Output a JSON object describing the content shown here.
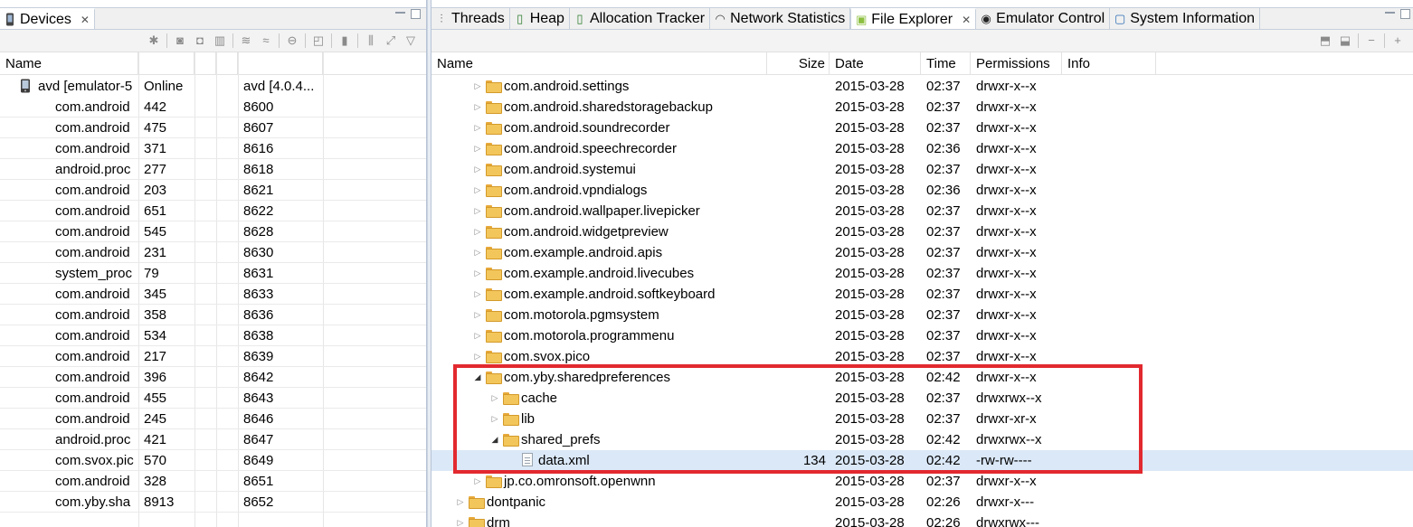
{
  "devices_panel": {
    "tab_label": "Devices",
    "columns": [
      "Name",
      "",
      "",
      "",
      ""
    ],
    "device": {
      "name": "avd [emulator-5",
      "status": "Online",
      "version": "avd [4.0.4..."
    },
    "processes": [
      {
        "name": "com.android",
        "pid": "442",
        "port": "8600"
      },
      {
        "name": "com.android",
        "pid": "475",
        "port": "8607"
      },
      {
        "name": "com.android",
        "pid": "371",
        "port": "8616"
      },
      {
        "name": "android.proc",
        "pid": "277",
        "port": "8618"
      },
      {
        "name": "com.android",
        "pid": "203",
        "port": "8621"
      },
      {
        "name": "com.android",
        "pid": "651",
        "port": "8622"
      },
      {
        "name": "com.android",
        "pid": "545",
        "port": "8628"
      },
      {
        "name": "com.android",
        "pid": "231",
        "port": "8630"
      },
      {
        "name": "system_proc",
        "pid": "79",
        "port": "8631"
      },
      {
        "name": "com.android",
        "pid": "345",
        "port": "8633"
      },
      {
        "name": "com.android",
        "pid": "358",
        "port": "8636"
      },
      {
        "name": "com.android",
        "pid": "534",
        "port": "8638"
      },
      {
        "name": "com.android",
        "pid": "217",
        "port": "8639"
      },
      {
        "name": "com.android",
        "pid": "396",
        "port": "8642"
      },
      {
        "name": "com.android",
        "pid": "455",
        "port": "8643"
      },
      {
        "name": "com.android",
        "pid": "245",
        "port": "8646"
      },
      {
        "name": "android.proc",
        "pid": "421",
        "port": "8647"
      },
      {
        "name": "com.svox.pic",
        "pid": "570",
        "port": "8649"
      },
      {
        "name": "com.android",
        "pid": "328",
        "port": "8651"
      },
      {
        "name": "com.yby.sha",
        "pid": "8913",
        "port": "8652"
      }
    ]
  },
  "right_tabs": [
    {
      "label": "Threads",
      "icon": "threads-icon"
    },
    {
      "label": "Heap",
      "icon": "heap-icon"
    },
    {
      "label": "Allocation Tracker",
      "icon": "allocation-icon"
    },
    {
      "label": "Network Statistics",
      "icon": "network-icon"
    },
    {
      "label": "File Explorer",
      "icon": "android-icon"
    },
    {
      "label": "Emulator Control",
      "icon": "emulator-icon"
    },
    {
      "label": "System Information",
      "icon": "sysinfo-icon"
    }
  ],
  "file_explorer": {
    "columns": [
      "Name",
      "Size",
      "Date",
      "Time",
      "Permissions",
      "Info"
    ],
    "entries": [
      {
        "name": "com.android.settings",
        "size": "",
        "date": "2015-03-28",
        "time": "02:37",
        "perm": "drwxr-x--x",
        "type": "folder",
        "expanded": false
      },
      {
        "name": "com.android.sharedstoragebackup",
        "size": "",
        "date": "2015-03-28",
        "time": "02:37",
        "perm": "drwxr-x--x",
        "type": "folder",
        "expanded": false
      },
      {
        "name": "com.android.soundrecorder",
        "size": "",
        "date": "2015-03-28",
        "time": "02:37",
        "perm": "drwxr-x--x",
        "type": "folder",
        "expanded": false
      },
      {
        "name": "com.android.speechrecorder",
        "size": "",
        "date": "2015-03-28",
        "time": "02:36",
        "perm": "drwxr-x--x",
        "type": "folder",
        "expanded": false
      },
      {
        "name": "com.android.systemui",
        "size": "",
        "date": "2015-03-28",
        "time": "02:37",
        "perm": "drwxr-x--x",
        "type": "folder",
        "expanded": false
      },
      {
        "name": "com.android.vpndialogs",
        "size": "",
        "date": "2015-03-28",
        "time": "02:36",
        "perm": "drwxr-x--x",
        "type": "folder",
        "expanded": false
      },
      {
        "name": "com.android.wallpaper.livepicker",
        "size": "",
        "date": "2015-03-28",
        "time": "02:37",
        "perm": "drwxr-x--x",
        "type": "folder",
        "expanded": false
      },
      {
        "name": "com.android.widgetpreview",
        "size": "",
        "date": "2015-03-28",
        "time": "02:37",
        "perm": "drwxr-x--x",
        "type": "folder",
        "expanded": false
      },
      {
        "name": "com.example.android.apis",
        "size": "",
        "date": "2015-03-28",
        "time": "02:37",
        "perm": "drwxr-x--x",
        "type": "folder",
        "expanded": false
      },
      {
        "name": "com.example.android.livecubes",
        "size": "",
        "date": "2015-03-28",
        "time": "02:37",
        "perm": "drwxr-x--x",
        "type": "folder",
        "expanded": false
      },
      {
        "name": "com.example.android.softkeyboard",
        "size": "",
        "date": "2015-03-28",
        "time": "02:37",
        "perm": "drwxr-x--x",
        "type": "folder",
        "expanded": false
      },
      {
        "name": "com.motorola.pgmsystem",
        "size": "",
        "date": "2015-03-28",
        "time": "02:37",
        "perm": "drwxr-x--x",
        "type": "folder",
        "expanded": false
      },
      {
        "name": "com.motorola.programmenu",
        "size": "",
        "date": "2015-03-28",
        "time": "02:37",
        "perm": "drwxr-x--x",
        "type": "folder",
        "expanded": false
      },
      {
        "name": "com.svox.pico",
        "size": "",
        "date": "2015-03-28",
        "time": "02:37",
        "perm": "drwxr-x--x",
        "type": "folder",
        "expanded": false
      },
      {
        "name": "com.yby.sharedpreferences",
        "size": "",
        "date": "2015-03-28",
        "time": "02:42",
        "perm": "drwxr-x--x",
        "type": "folder",
        "expanded": true
      },
      {
        "name": "cache",
        "size": "",
        "date": "2015-03-28",
        "time": "02:37",
        "perm": "drwxrwx--x",
        "type": "folder",
        "expanded": false
      },
      {
        "name": "lib",
        "size": "",
        "date": "2015-03-28",
        "time": "02:37",
        "perm": "drwxr-xr-x",
        "type": "folder",
        "expanded": false
      },
      {
        "name": "shared_prefs",
        "size": "",
        "date": "2015-03-28",
        "time": "02:42",
        "perm": "drwxrwx--x",
        "type": "folder",
        "expanded": true
      },
      {
        "name": "data.xml",
        "size": "134",
        "date": "2015-03-28",
        "time": "02:42",
        "perm": "-rw-rw----",
        "type": "file",
        "expanded": false,
        "selected": true
      },
      {
        "name": "jp.co.omronsoft.openwnn",
        "size": "",
        "date": "2015-03-28",
        "time": "02:37",
        "perm": "drwxr-x--x",
        "type": "folder",
        "expanded": false
      },
      {
        "name": "dontpanic",
        "size": "",
        "date": "2015-03-28",
        "time": "02:26",
        "perm": "drwxr-x---",
        "type": "folder",
        "expanded": false
      },
      {
        "name": "drm",
        "size": "",
        "date": "2015-03-28",
        "time": "02:26",
        "perm": "drwxrwx---",
        "type": "folder",
        "expanded": false
      }
    ]
  },
  "colors": {
    "highlight": "#e2292f",
    "selection": "#dbe8f7",
    "folder": "#f3c65b"
  }
}
